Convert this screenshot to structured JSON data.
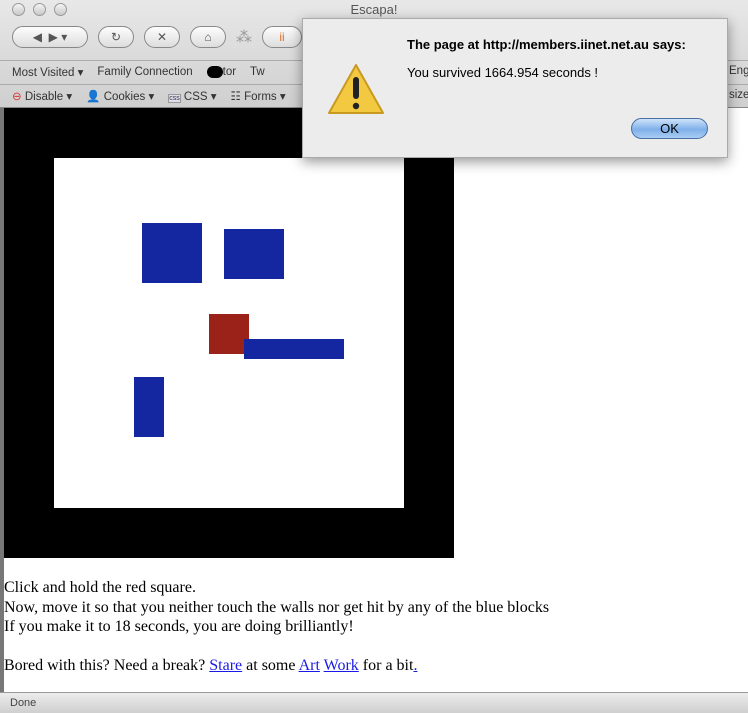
{
  "window": {
    "title": "Escapa!"
  },
  "bookmarks": [
    "Most Visited ▾",
    "Family Connection",
    "tor",
    "Tw",
    "Enga"
  ],
  "devbar": [
    "Disable ▾",
    "Cookies ▾",
    "CSS ▾",
    "Forms ▾",
    "size"
  ],
  "game": {
    "red_color": "#9b2218",
    "blue_color": "#1427a0"
  },
  "instructions": {
    "line1": "Click and hold the red square.",
    "line2": "Now, move it so that you neither touch the walls nor get hit by any of the blue blocks",
    "line3": "If you make it to 18 seconds, you are doing brilliantly!",
    "bored": "Bored with this? Need a break? ",
    "stare": "Stare",
    "at_some": " at some ",
    "art": "Art",
    "work": "Work",
    "for_a_bit": " for a bit",
    "dot": "."
  },
  "status": "Done",
  "dialog": {
    "heading": "The page at http://members.iinet.net.au says:",
    "message": "You survived 1664.954 seconds !",
    "ok": "OK",
    "icon": "warning-icon"
  }
}
